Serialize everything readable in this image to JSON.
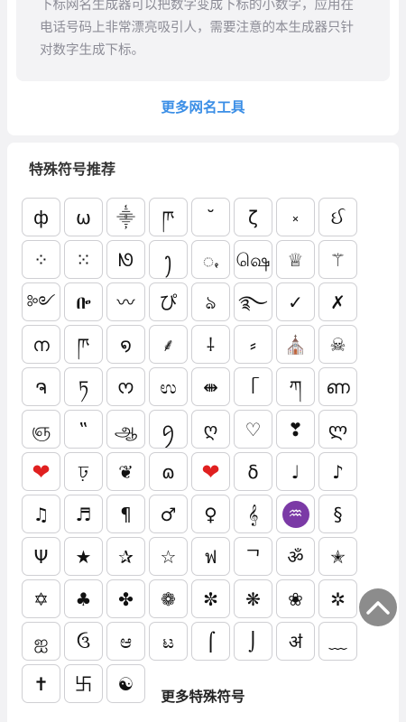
{
  "intro": {
    "description": "下标网名生成器可以把数字变成下标的小数字，应用在电话号码上非常漂亮吸引人，需要注意的本生成器只针对数字生成下标。",
    "more_tools_link": "更多网名工具"
  },
  "symbols_section": {
    "title": "特殊符号推荐",
    "symbols": [
      {
        "char": "ф",
        "variant": ""
      },
      {
        "char": "ω",
        "variant": ""
      },
      {
        "char": "⸎",
        "variant": ""
      },
      {
        "char": "ཫ",
        "variant": ""
      },
      {
        "char": "˘",
        "variant": ""
      },
      {
        "char": "ζ",
        "variant": ""
      },
      {
        "char": "༝",
        "variant": ""
      },
      {
        "char": "ઈ",
        "variant": ""
      },
      {
        "char": "⁘",
        "variant": ""
      },
      {
        "char": "⁙",
        "variant": ""
      },
      {
        "char": "ᘚ",
        "variant": ""
      },
      {
        "char": "ꫂ",
        "variant": ""
      },
      {
        "char": "ꩻ",
        "variant": ""
      },
      {
        "char": "ஷெ",
        "variant": ""
      },
      {
        "char": "♕",
        "variant": ""
      },
      {
        "char": "⚚",
        "variant": ""
      },
      {
        "char": "༻",
        "variant": ""
      },
      {
        "char": "ᎄ",
        "variant": ""
      },
      {
        "char": "〰",
        "variant": ""
      },
      {
        "char": "ぴ",
        "variant": ""
      },
      {
        "char": "ঌ",
        "variant": ""
      },
      {
        "char": "࿐",
        "variant": ""
      },
      {
        "char": "✓",
        "variant": ""
      },
      {
        "char": "✗",
        "variant": ""
      },
      {
        "char": "ന",
        "variant": ""
      },
      {
        "char": "ཫ",
        "variant": ""
      },
      {
        "char": "໑",
        "variant": ""
      },
      {
        "char": "⸙",
        "variant": ""
      },
      {
        "char": "⸸",
        "variant": ""
      },
      {
        "char": "⸗",
        "variant": ""
      },
      {
        "char": "⛪",
        "variant": ""
      },
      {
        "char": "☠",
        "variant": ""
      },
      {
        "char": "ຈ",
        "variant": ""
      },
      {
        "char": "ཏ",
        "variant": ""
      },
      {
        "char": "ᰔ",
        "variant": ""
      },
      {
        "char": "ಉ",
        "variant": ""
      },
      {
        "char": "⇼",
        "variant": ""
      },
      {
        "char": "ᥬ",
        "variant": ""
      },
      {
        "char": "ཀ",
        "variant": ""
      },
      {
        "char": "ണ",
        "variant": ""
      },
      {
        "char": "ஞ",
        "variant": ""
      },
      {
        "char": "‟",
        "variant": ""
      },
      {
        "char": "ஆ",
        "variant": ""
      },
      {
        "char": "ꪇ",
        "variant": ""
      },
      {
        "char": "ღ",
        "variant": ""
      },
      {
        "char": "♡",
        "variant": ""
      },
      {
        "char": "❣",
        "variant": ""
      },
      {
        "char": "ლ",
        "variant": ""
      },
      {
        "char": "❤",
        "variant": "red"
      },
      {
        "char": "ঢ়",
        "variant": ""
      },
      {
        "char": "❦",
        "variant": ""
      },
      {
        "char": "ɷ",
        "variant": ""
      },
      {
        "char": "❤",
        "variant": "red"
      },
      {
        "char": "δ",
        "variant": ""
      },
      {
        "char": "♩",
        "variant": ""
      },
      {
        "char": "♪",
        "variant": ""
      },
      {
        "char": "♫",
        "variant": ""
      },
      {
        "char": "♬",
        "variant": ""
      },
      {
        "char": "¶",
        "variant": ""
      },
      {
        "char": "♂",
        "variant": ""
      },
      {
        "char": "♀",
        "variant": ""
      },
      {
        "char": "𝄞",
        "variant": ""
      },
      {
        "char": "♒",
        "variant": "aqua"
      },
      {
        "char": "§",
        "variant": ""
      },
      {
        "char": "Ψ",
        "variant": ""
      },
      {
        "char": "★",
        "variant": ""
      },
      {
        "char": "✰",
        "variant": ""
      },
      {
        "char": "☆",
        "variant": ""
      },
      {
        "char": "ฟ",
        "variant": ""
      },
      {
        "char": "ᄀ",
        "variant": ""
      },
      {
        "char": "ॐ",
        "variant": ""
      },
      {
        "char": "✭",
        "variant": ""
      },
      {
        "char": "✡",
        "variant": ""
      },
      {
        "char": "♣",
        "variant": ""
      },
      {
        "char": "✤",
        "variant": ""
      },
      {
        "char": "❁",
        "variant": ""
      },
      {
        "char": "✼",
        "variant": ""
      },
      {
        "char": "❋",
        "variant": ""
      },
      {
        "char": "❀",
        "variant": ""
      },
      {
        "char": "✲",
        "variant": ""
      },
      {
        "char": "ஐ",
        "variant": ""
      },
      {
        "char": "ઉ",
        "variant": ""
      },
      {
        "char": "ಆ",
        "variant": ""
      },
      {
        "char": "ಟ",
        "variant": ""
      },
      {
        "char": "⌠",
        "variant": ""
      },
      {
        "char": "⌡",
        "variant": ""
      },
      {
        "char": "ॳ",
        "variant": ""
      },
      {
        "char": "﹏",
        "variant": ""
      },
      {
        "char": "✝",
        "variant": ""
      },
      {
        "char": "卐",
        "variant": ""
      },
      {
        "char": "☯",
        "variant": ""
      }
    ],
    "more_symbols_link": "更多特殊符号"
  },
  "scroll_top_icon": "chevron-up-icon",
  "colors": {
    "link": "#3a8ee6",
    "page_bg": "#f2f2f4",
    "card_bg": "#ffffff",
    "border": "#cfcfd3",
    "heart": "#e02020",
    "aquarius_bg": "#7b3aa6",
    "scroll_button": "#8c8c8c"
  }
}
